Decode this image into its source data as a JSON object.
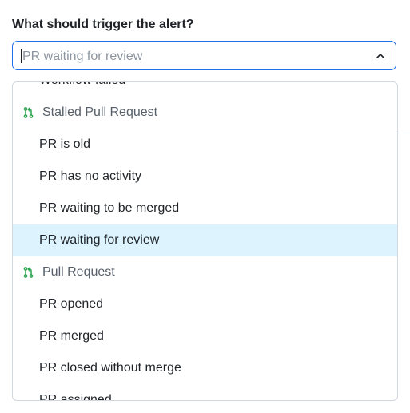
{
  "form": {
    "label": "What should trigger the alert?",
    "select": {
      "placeholder": "PR waiting for review"
    }
  },
  "colors": {
    "focus_border": "#1f6feb",
    "selected_bg": "#ddf4ff",
    "pr_icon": "#2da44e"
  },
  "dropdown": {
    "items": [
      {
        "type": "option",
        "label": "Workflow failed"
      },
      {
        "type": "group",
        "label": "Stalled Pull Request",
        "icon": "pull-request-icon"
      },
      {
        "type": "option",
        "label": "PR is old"
      },
      {
        "type": "option",
        "label": "PR has no activity"
      },
      {
        "type": "option",
        "label": "PR waiting to be merged"
      },
      {
        "type": "option",
        "label": "PR waiting for review",
        "selected": true
      },
      {
        "type": "group",
        "label": "Pull Request",
        "icon": "pull-request-icon"
      },
      {
        "type": "option",
        "label": "PR opened"
      },
      {
        "type": "option",
        "label": "PR merged"
      },
      {
        "type": "option",
        "label": "PR closed without merge"
      },
      {
        "type": "option",
        "label": "PR assigned"
      }
    ]
  }
}
